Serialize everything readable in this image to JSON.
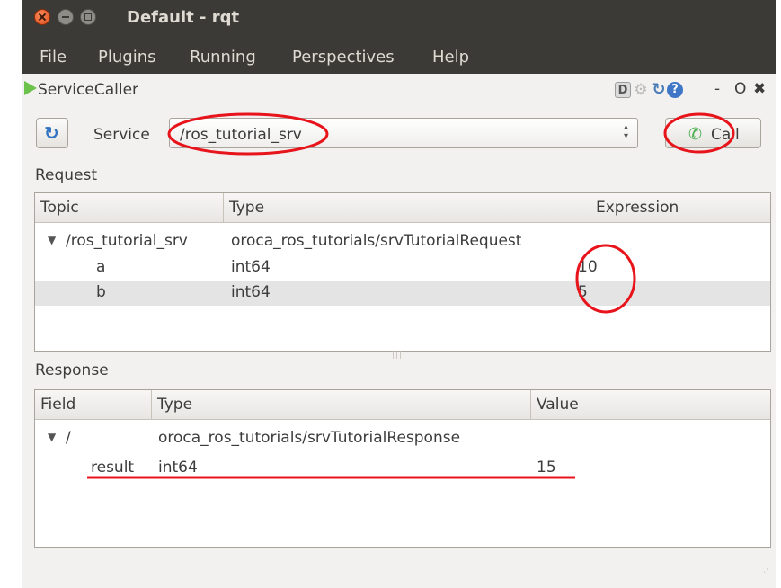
{
  "window": {
    "title": "Default - rqt"
  },
  "menu": [
    "File",
    "Plugins",
    "Running",
    "Perspectives",
    "Help"
  ],
  "plugin": {
    "name": "ServiceCaller",
    "header_icons": [
      "d-icon",
      "gear-icon",
      "reload-icon",
      "help-icon"
    ],
    "controls": {
      "minimize": "-",
      "float": "O",
      "close": "✖"
    }
  },
  "service": {
    "label": "Service",
    "value": "/ros_tutorial_srv",
    "call_label": "Call",
    "icons": {
      "refresh": "refresh-icon",
      "call": "phone-icon"
    }
  },
  "request": {
    "section_label": "Request",
    "columns": [
      "Topic",
      "Type",
      "Expression"
    ],
    "rows": [
      {
        "topic": "/ros_tutorial_srv",
        "type": "oroca_ros_tutorials/srvTutorialRequest",
        "expression": ""
      },
      {
        "topic": "a",
        "type": "int64",
        "expression": "10"
      },
      {
        "topic": "b",
        "type": "int64",
        "expression": "5"
      }
    ],
    "selected_row": 2
  },
  "response": {
    "section_label": "Response",
    "columns": [
      "Field",
      "Type",
      "Value"
    ],
    "rows": [
      {
        "field": "/",
        "type": "oroca_ros_tutorials/srvTutorialResponse",
        "value": ""
      },
      {
        "field": "result",
        "type": "int64",
        "value": "15"
      }
    ]
  },
  "colors": {
    "titlebar": "#3b3a36",
    "window_bg": "#f2f1f0",
    "annotation": "#e8141b",
    "selection": "#e4e4e4"
  }
}
